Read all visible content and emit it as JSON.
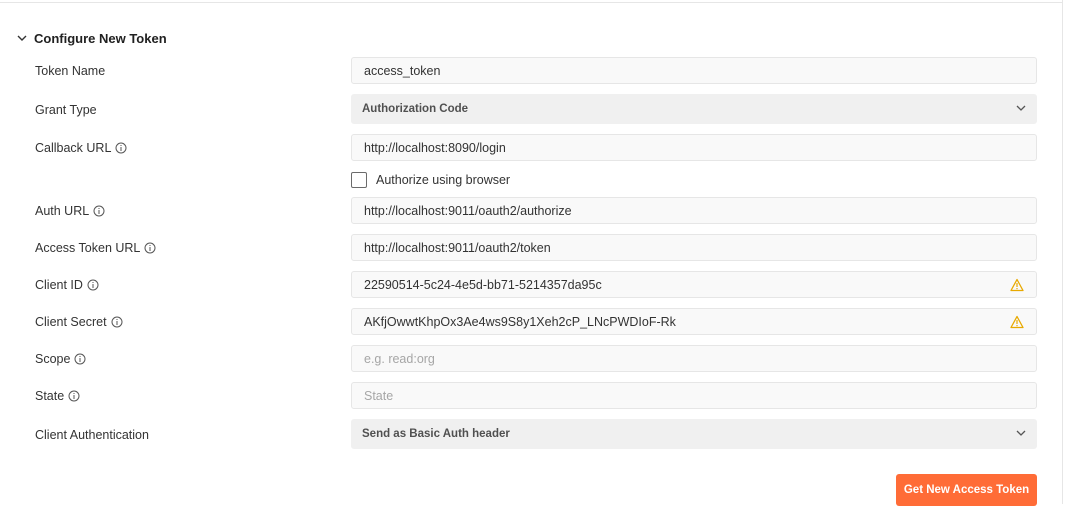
{
  "section": {
    "title": "Configure New Token"
  },
  "fields": {
    "token_name": {
      "label": "Token Name",
      "value": "access_token"
    },
    "grant_type": {
      "label": "Grant Type",
      "value": "Authorization Code"
    },
    "callback_url": {
      "label": "Callback URL",
      "value": "http://localhost:8090/login"
    },
    "authorize_browser": {
      "label": "Authorize using browser",
      "checked": false
    },
    "auth_url": {
      "label": "Auth URL",
      "value": "http://localhost:9011/oauth2/authorize"
    },
    "access_token_url": {
      "label": "Access Token URL",
      "value": "http://localhost:9011/oauth2/token"
    },
    "client_id": {
      "label": "Client ID",
      "value": "22590514-5c24-4e5d-bb71-5214357da95c"
    },
    "client_secret": {
      "label": "Client Secret",
      "value": "AKfjOwwtKhpOx3Ae4ws9S8y1Xeh2cP_LNcPWDIoF-Rk"
    },
    "scope": {
      "label": "Scope",
      "placeholder": "e.g. read:org"
    },
    "state": {
      "label": "State",
      "placeholder": "State"
    },
    "client_auth": {
      "label": "Client Authentication",
      "value": "Send as Basic Auth header"
    }
  },
  "actions": {
    "get_token_label": "Get New Access Token"
  },
  "colors": {
    "accent": "#ff6c37",
    "warning": "#e8a900"
  },
  "icons": [
    "chevron-down-icon",
    "info-icon",
    "warning-icon"
  ]
}
